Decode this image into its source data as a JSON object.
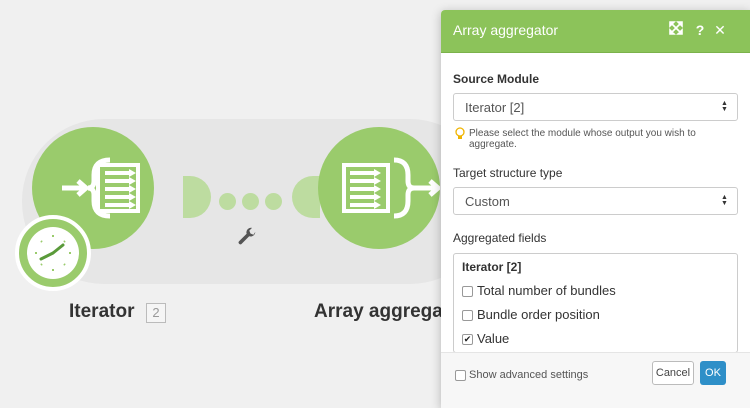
{
  "scenario": {
    "modules": [
      {
        "label": "Iterator",
        "badge": "2"
      },
      {
        "label": "Array aggregator"
      }
    ]
  },
  "panel": {
    "title": "Array aggregator",
    "header_icons": [
      "expand-icon",
      "help-icon",
      "close-icon"
    ],
    "source_module_label": "Source Module",
    "source_module_value": "Iterator [2]",
    "source_module_hint": "Please select the module whose output you wish to aggregate.",
    "target_label": "Target structure type",
    "target_value": "Custom",
    "aggregated_label": "Aggregated fields",
    "aggregated_group": "Iterator [2]",
    "aggregated_fields": [
      {
        "label": "Total number of bundles",
        "checked": false
      },
      {
        "label": "Bundle order position",
        "checked": false
      },
      {
        "label": "Value",
        "checked": true
      }
    ],
    "advanced_label": "Show advanced settings",
    "cancel_label": "Cancel",
    "ok_label": "OK"
  },
  "colors": {
    "module_green": "#9acb6c",
    "header_green": "#8cc35a",
    "ok_blue": "#2e8fc8"
  }
}
